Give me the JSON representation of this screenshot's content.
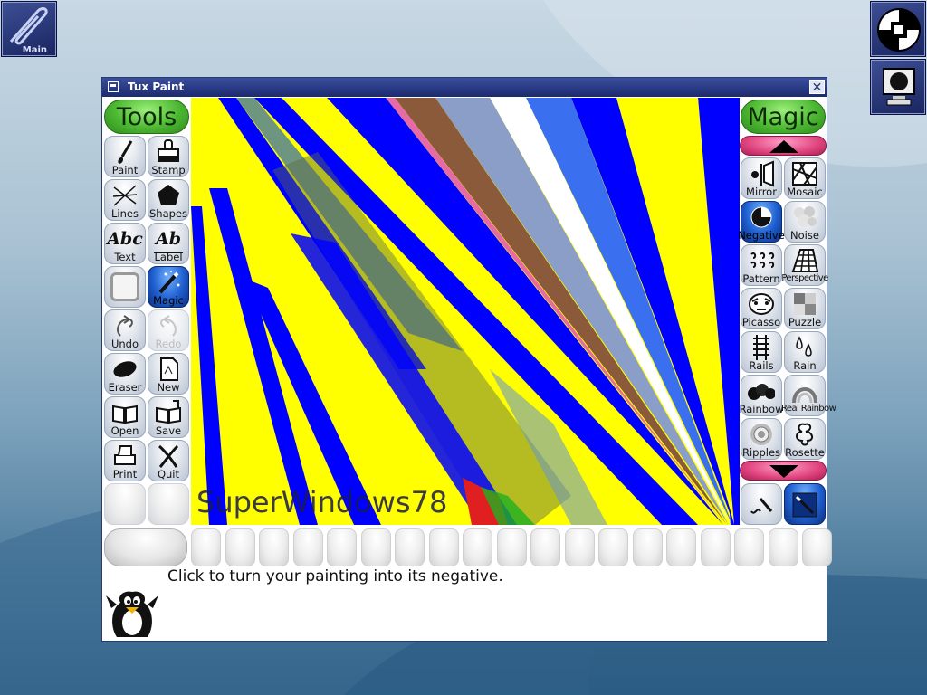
{
  "desktop": {
    "main_icon_label": "Main"
  },
  "window": {
    "title": "Tux Paint",
    "close_glyph": "✕"
  },
  "tools_panel": {
    "header": "Tools",
    "items": [
      {
        "label": "Paint",
        "icon": "paintbrush-icon"
      },
      {
        "label": "Stamp",
        "icon": "stamp-icon"
      },
      {
        "label": "Lines",
        "icon": "lines-icon"
      },
      {
        "label": "Shapes",
        "icon": "pentagon-icon"
      },
      {
        "label": "Text",
        "icon": "text-icon"
      },
      {
        "label": "Label",
        "icon": "label-icon"
      },
      {
        "label": "",
        "icon": "blank-icon"
      },
      {
        "label": "Magic",
        "icon": "magic-wand-icon"
      },
      {
        "label": "Undo",
        "icon": "undo-icon"
      },
      {
        "label": "Redo",
        "icon": "redo-icon"
      },
      {
        "label": "Eraser",
        "icon": "eraser-icon"
      },
      {
        "label": "New",
        "icon": "new-page-icon"
      },
      {
        "label": "Open",
        "icon": "open-book-icon"
      },
      {
        "label": "Save",
        "icon": "save-book-icon"
      },
      {
        "label": "Print",
        "icon": "printer-icon"
      },
      {
        "label": "Quit",
        "icon": "quit-x-icon"
      }
    ],
    "text_glyph": "Abc",
    "label_glyph": "Ab"
  },
  "magic_panel": {
    "header": "Magic",
    "items": [
      {
        "label": "Mirror",
        "icon": "mirror-icon"
      },
      {
        "label": "Mosaic",
        "icon": "mosaic-icon"
      },
      {
        "label": "Negative",
        "icon": "negative-icon"
      },
      {
        "label": "Noise",
        "icon": "noise-icon"
      },
      {
        "label": "Pattern",
        "icon": "pattern-icon"
      },
      {
        "label": "Perspective",
        "icon": "perspective-icon"
      },
      {
        "label": "Picasso",
        "icon": "picasso-icon"
      },
      {
        "label": "Puzzle",
        "icon": "puzzle-icon"
      },
      {
        "label": "Rails",
        "icon": "rails-icon"
      },
      {
        "label": "Rain",
        "icon": "rain-icon"
      },
      {
        "label": "Rainbow",
        "icon": "rainbow-icon"
      },
      {
        "label": "Real Rainbow",
        "icon": "real-rainbow-icon"
      },
      {
        "label": "Ripples",
        "icon": "ripples-icon"
      },
      {
        "label": "Rosette",
        "icon": "rosette-icon"
      }
    ],
    "selected": "Negative"
  },
  "canvas": {
    "overlay_text": "SuperWindows78"
  },
  "status": {
    "message": "Click to turn your painting into its negative."
  },
  "colors": {
    "accent_green": "#4cb832",
    "accent_pink": "#e0447e",
    "selected_blue": "#1f5fd0"
  }
}
